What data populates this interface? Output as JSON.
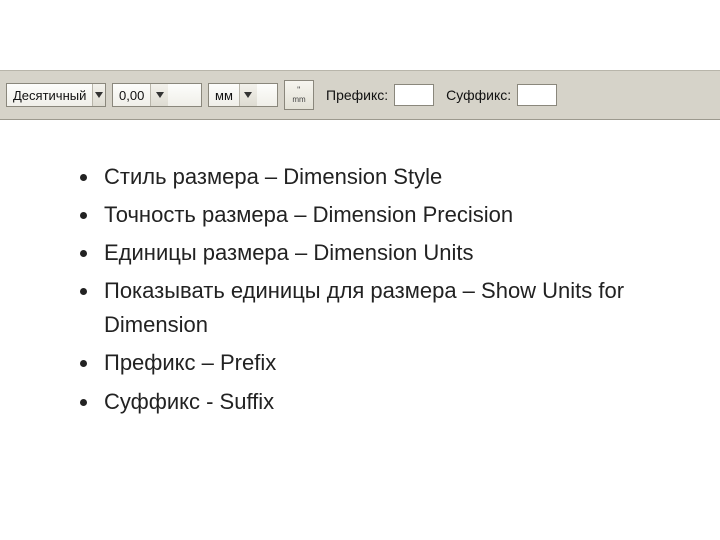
{
  "toolbar": {
    "style_value": "Десятичный",
    "precision_value": "0,00",
    "units_value": "мм",
    "show_units_btn": {
      "line1": "\"",
      "line2": "mm"
    },
    "prefix_label": "Префикс:",
    "prefix_value": "",
    "suffix_label": "Суффикс:",
    "suffix_value": ""
  },
  "bullets": [
    "Стиль размера – Dimension Style",
    "Точность размера – Dimension Precision",
    "Единицы размера – Dimension Units",
    "Показывать единицы для размера – Show Units for Dimension",
    "Префикс – Prefix",
    "Суффикс - Suffix"
  ]
}
